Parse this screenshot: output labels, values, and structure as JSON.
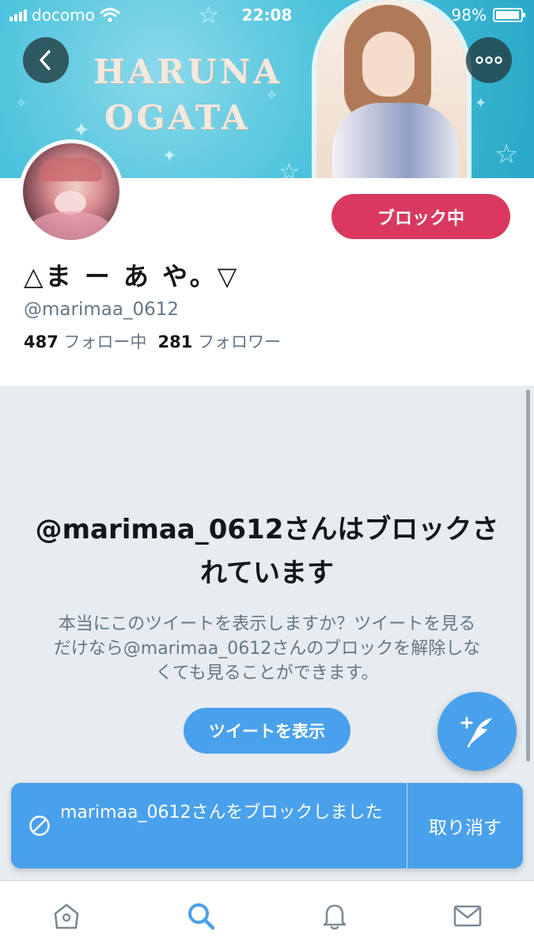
{
  "status_bar": {
    "carrier": "docomo",
    "time": "22:08",
    "battery_text": "98%",
    "battery_level": 0.98
  },
  "banner": {
    "title_line1": "HARUNA",
    "title_line2": "OGATA"
  },
  "profile": {
    "display_name": "△ま ー あ や。▽",
    "handle": "@marimaa_0612",
    "following_count": "487",
    "following_label": "フォロー中",
    "followers_count": "281",
    "followers_label": "フォロワー",
    "block_button_label": "ブロック中"
  },
  "blocked": {
    "title": "@marimaa_0612さんはブロックされています",
    "description": "本当にこのツイートを表示しますか？ツイートを見るだけなら@marimaa_0612さんのブロックを解除しなくても見ることができます。",
    "show_button_label": "ツイートを表示"
  },
  "toast": {
    "message": "marimaa_0612さんをブロックしました",
    "undo_label": "取り消す"
  },
  "tab_bar": {
    "items": [
      "home-icon",
      "search-icon",
      "notifications-icon",
      "messages-icon"
    ],
    "active": "search-icon"
  },
  "colors": {
    "accent": "#4aa1eb",
    "block_red": "#d9395f",
    "panel_bg": "#e6ecf0",
    "text_secondary": "#657786"
  }
}
